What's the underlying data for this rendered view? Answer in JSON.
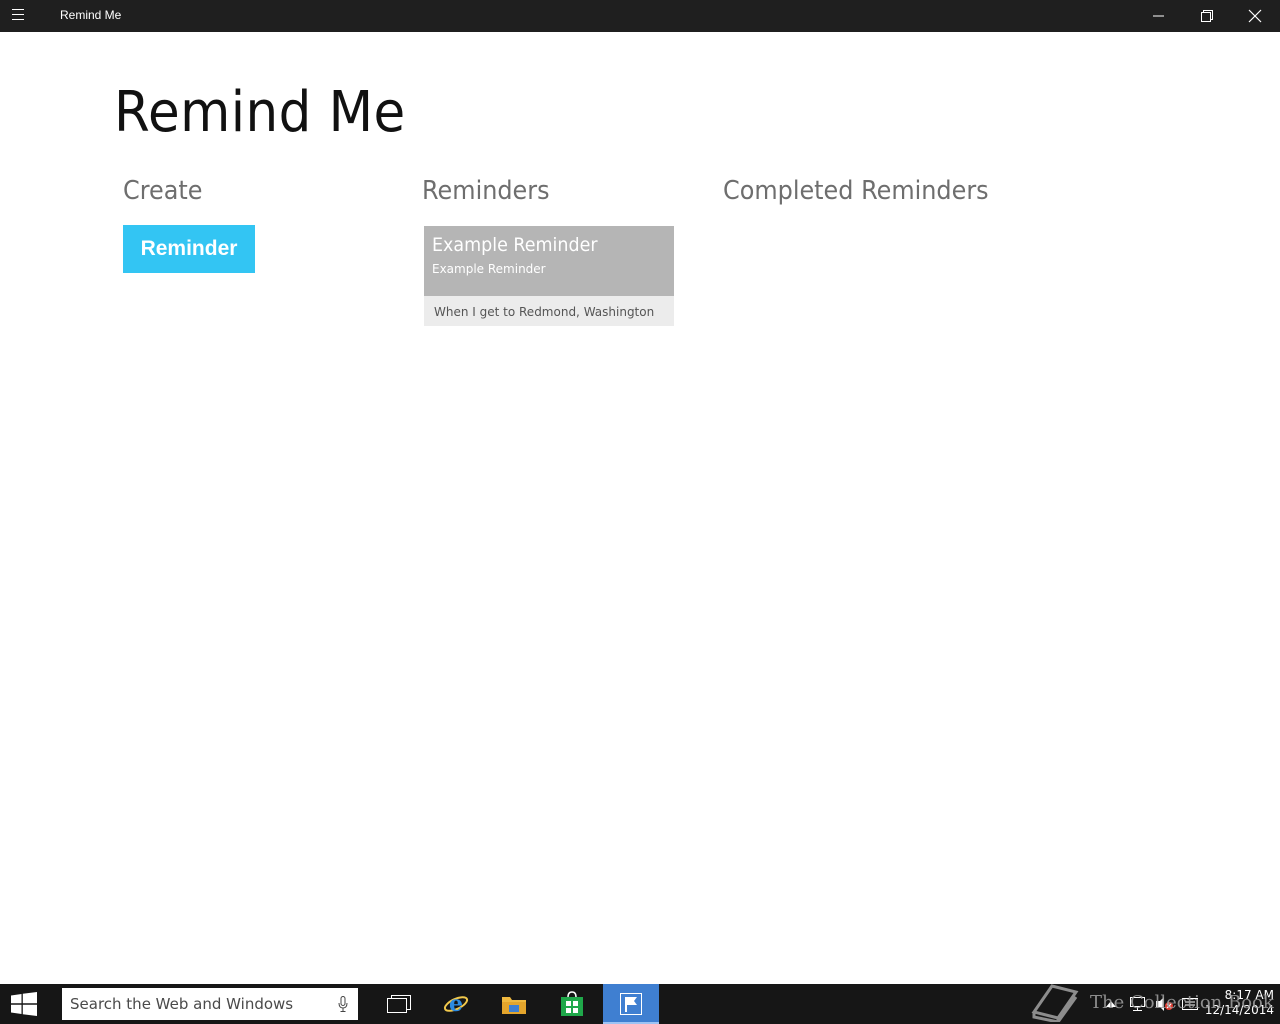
{
  "window": {
    "title": "Remind Me"
  },
  "page": {
    "title": "Remind Me"
  },
  "sections": {
    "create": "Create",
    "reminders": "Reminders",
    "completed": "Completed Reminders"
  },
  "create": {
    "button_label": "Reminder",
    "button_color": "#33c5f3"
  },
  "reminders": [
    {
      "title": "Example Reminder",
      "subtitle": "Example Reminder",
      "trigger": "When I get to Redmond, Washington"
    }
  ],
  "watermark": {
    "text": "The Collection Book",
    "icon": "book-icon"
  },
  "taskbar": {
    "search_placeholder": "Search the Web and Windows",
    "apps": [
      "task-view-icon",
      "internet-explorer-icon",
      "file-explorer-icon",
      "store-icon",
      "remind-me-app-icon"
    ],
    "tray": [
      "show-hidden-icons-icon",
      "network-icon",
      "volume-muted-icon",
      "action-center-icon"
    ],
    "time": "8:17 AM",
    "date": "12/14/2014"
  }
}
